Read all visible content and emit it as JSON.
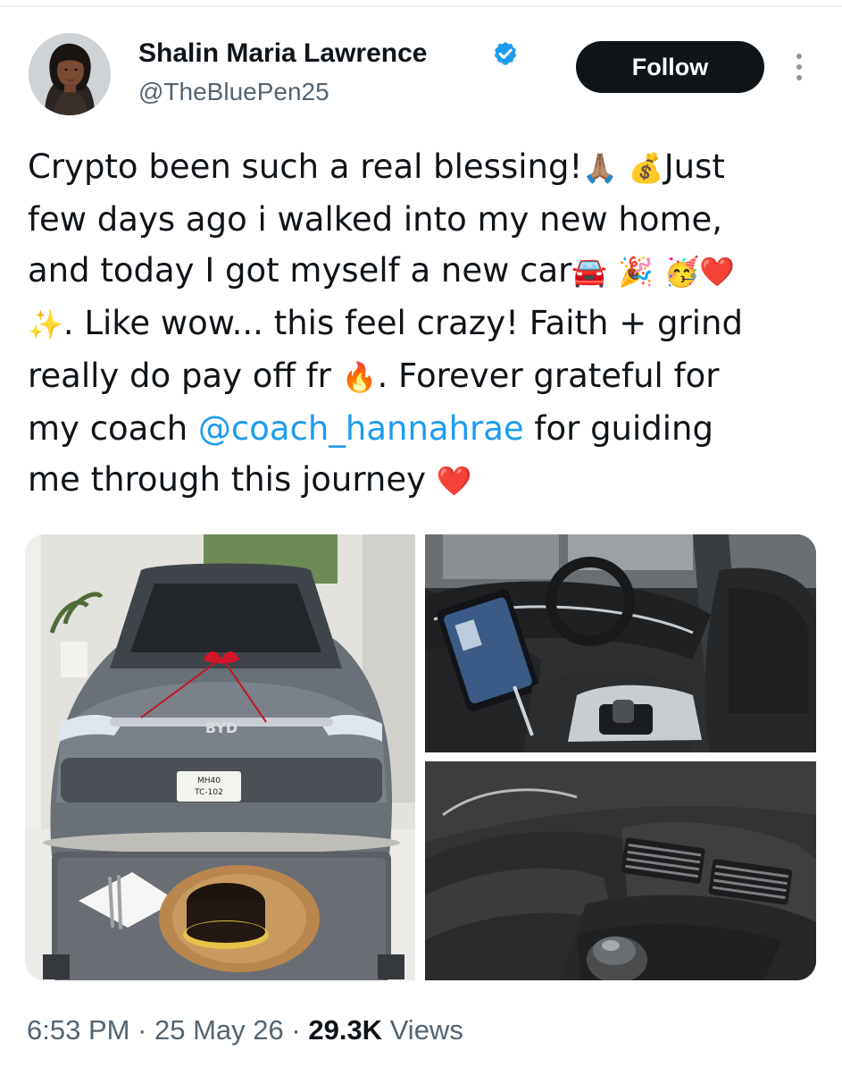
{
  "author": {
    "name": "Shalin Maria Lawrence",
    "handle": "@TheBluePen25",
    "verified": true,
    "avatar_icon": "profile-photo"
  },
  "actions": {
    "follow_label": "Follow",
    "more_icon": "more-vertical-icon"
  },
  "tweet": {
    "line1_a": "Crypto been such a real blessing!",
    "line1_e1": "🙏🏽",
    "line1_e2": "💰",
    "line1_b": "Just",
    "line2": "few days ago i walked into my new home,",
    "line3_a": "and today I got myself a new car",
    "line3_e1": "🚘",
    "line3_e2": "🎉",
    "line3_e3": "🥳",
    "line3_e4": "❤️",
    "line4_e1": "✨",
    "line4_b": ". Like wow... this feel crazy! Faith + grind",
    "line5_a": "really do pay off fr ",
    "line5_e1": "🔥",
    "line5_b": ". Forever grateful for",
    "line6_a": "my coach ",
    "line6_mention": "@coach_hannahrae",
    "line6_b": " for guiding",
    "line7_a": "me through this journey ",
    "line7_e1": "❤️"
  },
  "media": {
    "photos": [
      "car-showroom-photo",
      "car-dashboard-photo",
      "car-console-photo"
    ],
    "plate_line1": "MH40",
    "plate_line2": "TC-102",
    "grille_badge": "BYD"
  },
  "meta": {
    "time": "6:53 PM",
    "sep1": " · ",
    "date": "25 May 26",
    "sep2": " · ",
    "views_count": "29.3K",
    "views_label": " Views"
  },
  "colors": {
    "text": "#0f1419",
    "secondary": "#536471",
    "link": "#1d9bf0",
    "verified": "#1d9bf0",
    "button_bg": "#0f1419",
    "button_text": "#ffffff"
  }
}
